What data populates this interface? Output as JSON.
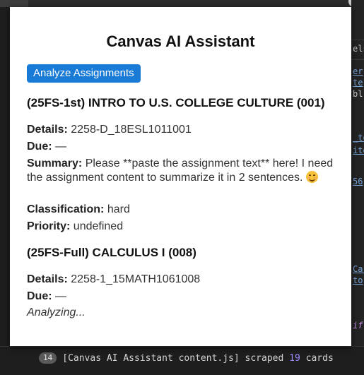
{
  "popup": {
    "title": "Canvas AI Assistant",
    "analyze_button": "Analyze Assignments",
    "courses": [
      {
        "name": "(25FS-1st) INTRO TO U.S. COLLEGE CULTURE (001)",
        "details_label": "Details:",
        "details": "2258-D_18ESL1011001",
        "due_label": "Due:",
        "due": "—",
        "summary_label": "Summary:",
        "summary": "Please **paste the assignment text** here! I need the assignment content to summarize it in 2 sentences.",
        "summary_emoji": "smiling-face-icon",
        "classification_label": "Classification:",
        "classification": "hard",
        "priority_label": "Priority:",
        "priority": "undefined"
      },
      {
        "name": "(25FS-Full) CALCULUS I (008)",
        "details_label": "Details:",
        "details": "2258-1_15MATH1061008",
        "due_label": "Due:",
        "due": "—",
        "status": "Analyzing..."
      }
    ]
  },
  "console": {
    "count": "14",
    "message_prefix": "[Canvas AI Assistant content.js] scraped",
    "cards": "19",
    "message_suffix": "cards"
  },
  "colors": {
    "button_bg": "#1a7bd6",
    "console_bg": "#1e1e1e",
    "console_number": "#9d8cff"
  }
}
